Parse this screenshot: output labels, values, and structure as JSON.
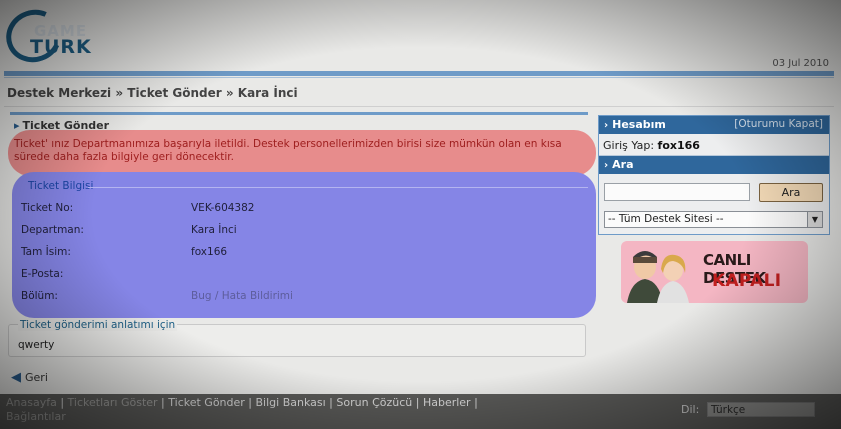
{
  "header": {
    "logo_top": "GAME",
    "logo_bottom": "TURK",
    "date": "03 Jul 2010"
  },
  "breadcrumb": "Destek Merkezi » Ticket Gönder » Kara İnci",
  "section_title": "Ticket Gönder",
  "alert_text": "Ticket' ınız Departmanımıza başarıyla iletildi. Destek personellerimizden birisi size mümkün olan en kısa sürede daha fazla bilgiyle geri dönecektir.",
  "ticket_info": {
    "legend": "Ticket Bilgisi",
    "rows": [
      {
        "label": "Ticket No:",
        "value": "VEK-604382"
      },
      {
        "label": "Departman:",
        "value": "Kara İnci"
      },
      {
        "label": "Tam İsim:",
        "value": "fox166"
      },
      {
        "label": "E-Posta:",
        "value": ""
      },
      {
        "label": "Bölüm:",
        "value": "Bug / Hata Bildirimi"
      }
    ]
  },
  "description": {
    "legend": "Ticket gönderimi anlatımı için",
    "value": "qwerty"
  },
  "back_label": "Geri",
  "footer": {
    "links": [
      "Anasayfa",
      "Ticketları Göster",
      "Ticket Gönder",
      "Bilgi Bankası",
      "Sorun Çözücü",
      "Haberler",
      "Bağlantılar"
    ],
    "lang_label": "Dil:",
    "lang_value": "Türkçe"
  },
  "sidebar": {
    "account_title": "Hesabım",
    "logout_label": "[Oturumu Kapat]",
    "login_prefix": "Giriş Yap:",
    "login_user": "fox166",
    "search_title": "Ara",
    "search_button": "Ara",
    "site_select": "-- Tüm Destek Sitesi --"
  },
  "banner": {
    "line1": "CANLI DESTEK",
    "line2": "KAPALI"
  }
}
